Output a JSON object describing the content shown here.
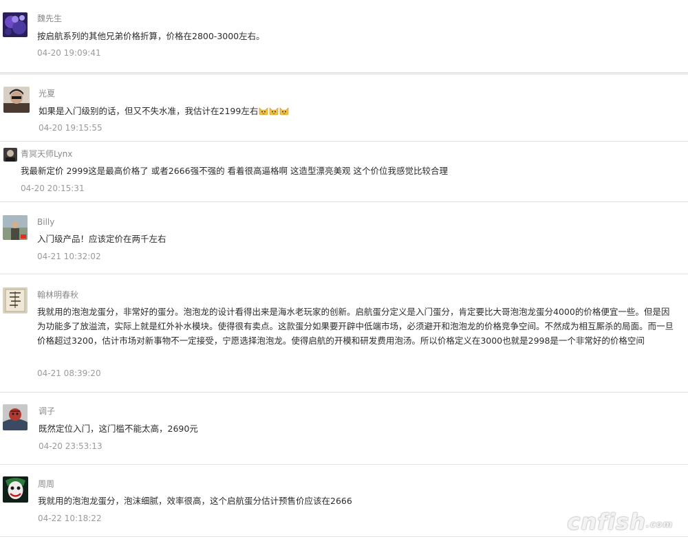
{
  "comments": [
    {
      "username": "魏先生",
      "text": "按启航系列的其他兄弟价格折算，价格在2800-3000左右。",
      "time": "04-20 19:09:41"
    },
    {
      "username": "光夏",
      "text": "如果是入门级别的话，但又不失水准，我估计在2199左右",
      "time": "04-20 19:15:55"
    },
    {
      "username": "青冥天师Lynx",
      "text": "我最新定价 2999这是最高价格了 或者2666强不强的 看着很高逼格啊 这造型漂亮美观 这个价位我感觉比较合理",
      "time": "04-20 20:15:31"
    },
    {
      "username": "Billy",
      "text": "入门级产品！应该定价在两千左右",
      "time": "04-21 10:32:02"
    },
    {
      "username": "翰林明春秋",
      "text": "我就用的泡泡龙蛋分，非常好的蛋分。泡泡龙的设计看得出来是海水老玩家的创新。启航蛋分定义是入门蛋分，肯定要比大哥泡泡龙蛋分4000的价格便宜一些。但是因为功能多了放溢流，实际上就是红外补水模块。使得很有卖点。这款蛋分如果要开辟中低端市场，必须避开和泡泡龙的价格竞争空间。不然成为相互厮杀的局面。而一旦价格超过3200，估计市场对新事物不一定接受，宁愿选择泡泡龙。使得启航的开模和研发费用泡汤。所以价格定义在3000也就是2998是一个非常好的价格空间",
      "time": "04-21 08:39:20"
    },
    {
      "username": "调子",
      "text": "既然定位入门，这门槛不能太高，2690元",
      "time": "04-20 23:53:13"
    },
    {
      "username": "周周",
      "text": "我就用的泡泡龙蛋分，泡沫细腻，效率很高，这个启航蛋分估计预售价应该在2666",
      "time": "04-22 10:18:22"
    }
  ],
  "watermark": "cnfish",
  "watermark_suffix": ".com"
}
